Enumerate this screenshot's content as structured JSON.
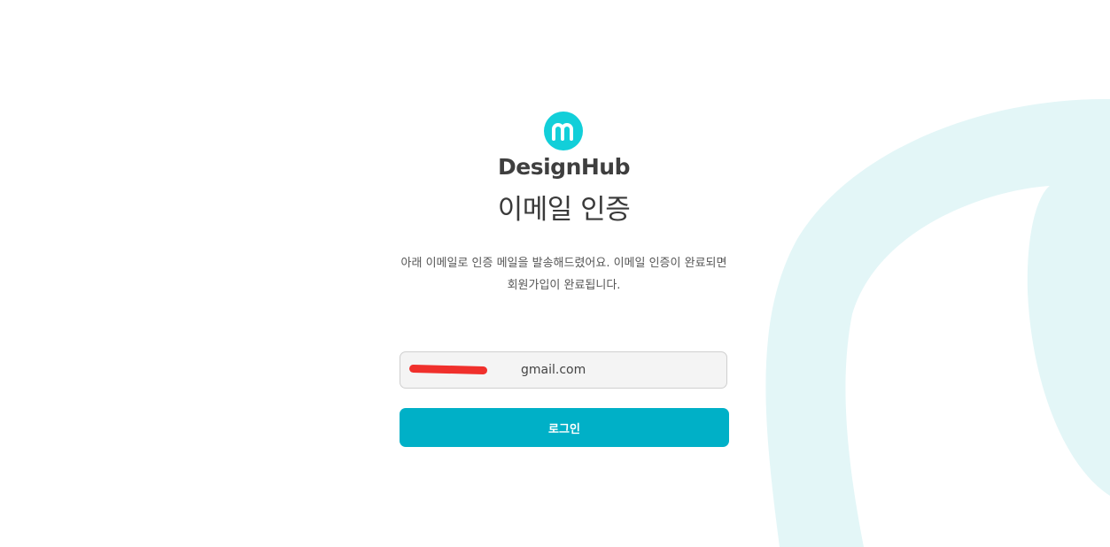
{
  "brand": {
    "name": "DesignHub",
    "logo_icon": "designhub-m-logo-icon",
    "logo_color": "#12cfd9"
  },
  "page": {
    "title": "이메일 인증",
    "description_line1": "아래 이메일로 인증 메일을 발송해드렸어요. 이메일 인증이 완료되면",
    "description_line2": "회원가입이 완료됩니다."
  },
  "form": {
    "email_value": "gmail.com",
    "login_label": "로그인",
    "accent_color": "#00b0c7",
    "redaction_color": "#f0302c"
  },
  "background": {
    "decor_color": "#e3f6f7"
  }
}
